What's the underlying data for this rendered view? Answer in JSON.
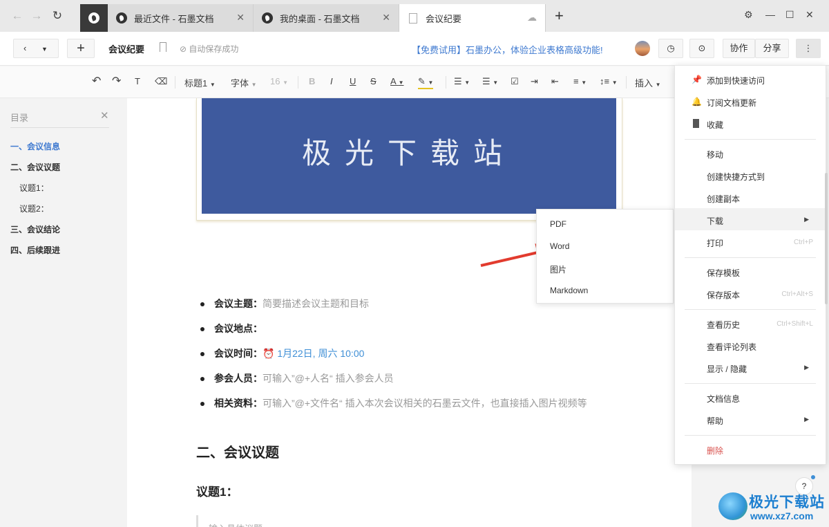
{
  "tabs": [
    {
      "label": "最近文件 - 石墨文档"
    },
    {
      "label": "我的桌面 - 石墨文档"
    },
    {
      "label": "会议纪要"
    }
  ],
  "header": {
    "doc_title": "会议纪要",
    "autosave": "自动保存成功",
    "promo": "【免费试用】石墨办公，体验企业表格高级功能!",
    "collab": "协作",
    "share": "分享",
    "more": "⋮"
  },
  "toolbar": {
    "heading": "标题1",
    "font": "字体",
    "size": "16",
    "insert": "插入"
  },
  "outline": {
    "title": "目录",
    "items": [
      "一、会议信息",
      "二、会议议题",
      "议题1：",
      "议题2：",
      "三、会议结论",
      "四、后续跟进"
    ]
  },
  "banner": {
    "text": "极光下载站"
  },
  "doc": {
    "rows": [
      {
        "label": "会议主题：",
        "value": "简要描述会议主题和目标"
      },
      {
        "label": "会议地点：",
        "value": ""
      },
      {
        "label": "会议时间：",
        "value": "1月22日, 周六 10:00"
      },
      {
        "label": "参会人员：",
        "value": "可输入”@+人名“ 插入参会人员"
      },
      {
        "label": "相关资料：",
        "value": "可输入”@+文件名“ 插入本次会议相关的石墨云文件，也直接插入图片视频等"
      }
    ],
    "h2": "二、会议议题",
    "h3": "议题1：",
    "quote": "输入具体议题"
  },
  "submenu": [
    "PDF",
    "Word",
    "图片",
    "Markdown"
  ],
  "menu": {
    "add_quick": "添加到快速访问",
    "subscribe": "订阅文档更新",
    "favorite": "收藏",
    "move": "移动",
    "shortcut": "创建快捷方式到",
    "copy": "创建副本",
    "download": "下载",
    "print": "打印",
    "print_sc": "Ctrl+P",
    "save_tpl": "保存模板",
    "save_ver": "保存版本",
    "save_ver_sc": "Ctrl+Alt+S",
    "history": "查看历史",
    "history_sc": "Ctrl+Shift+L",
    "comments": "查看评论列表",
    "showhide": "显示 / 隐藏",
    "info": "文档信息",
    "help": "帮助",
    "delete": "删除"
  },
  "watermark": {
    "title": "极光下载站",
    "url": "www.xz7.com"
  },
  "colors": {
    "accent": "#3f7ad0",
    "banner": "#3e5a9e",
    "arrow": "#e23b2e",
    "delete": "#d9534f"
  }
}
